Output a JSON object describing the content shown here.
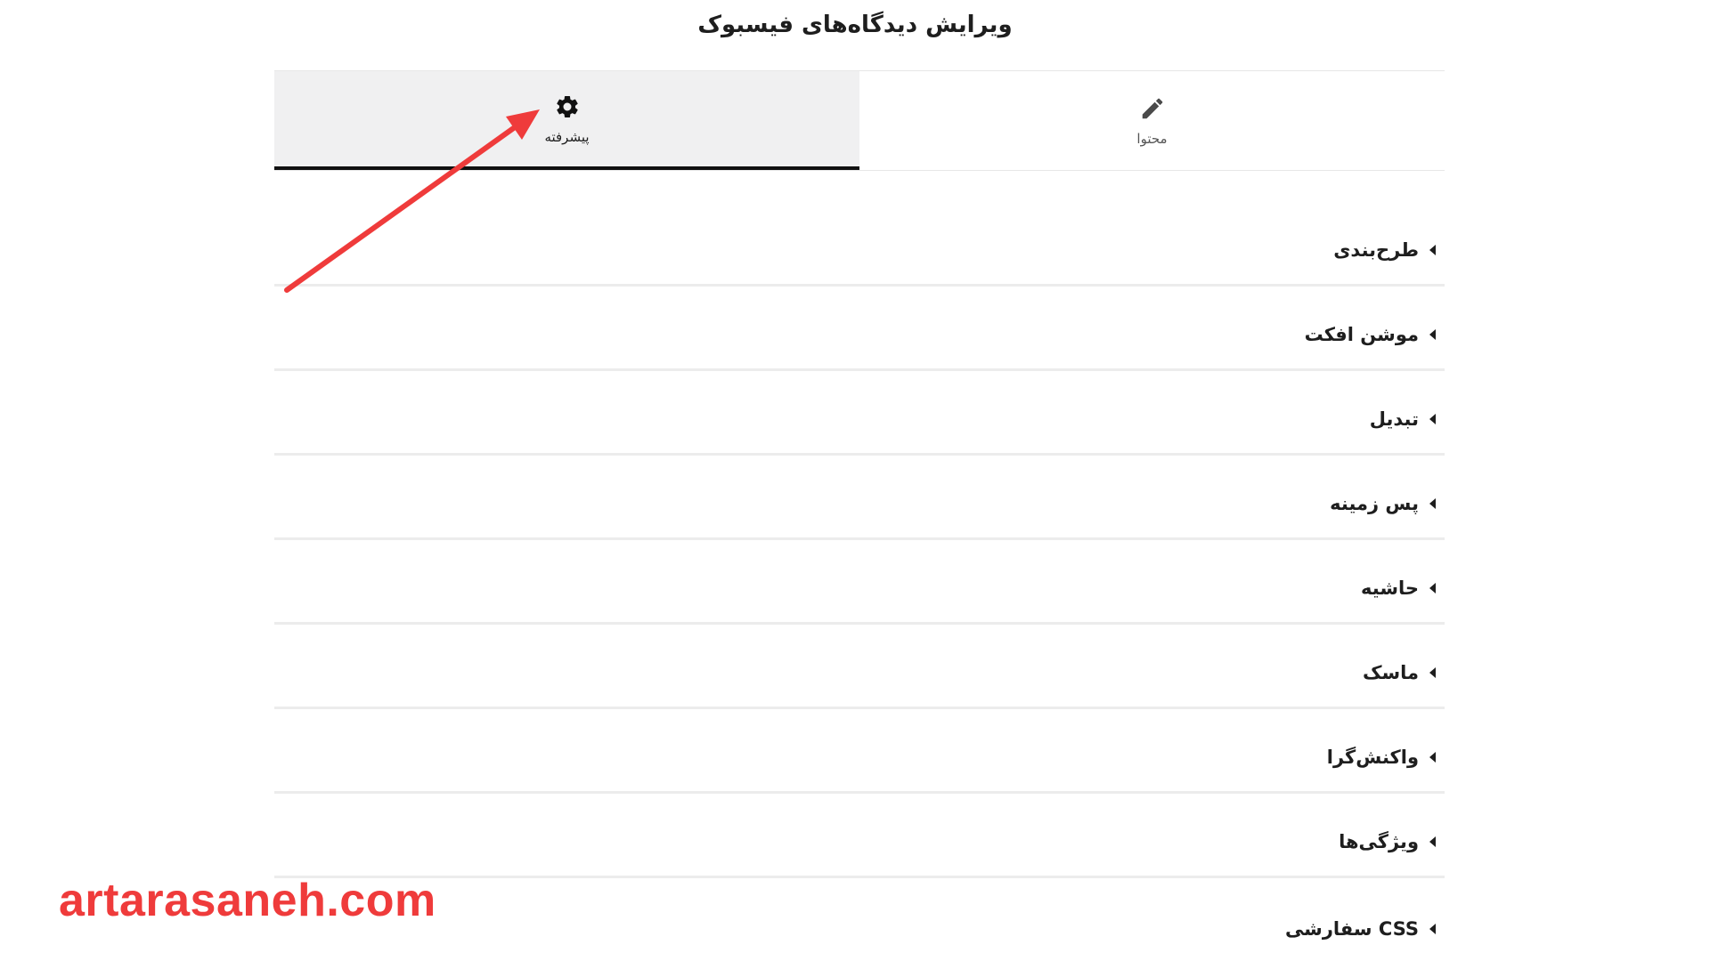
{
  "title": "ویرایش دیدگاه‌های فیسبوک",
  "tabs": [
    {
      "label": "محتوا",
      "icon": "pencil-icon",
      "active": false
    },
    {
      "label": "پیشرفته",
      "icon": "gear-icon",
      "active": true
    }
  ],
  "sections": [
    {
      "label": "طرح‌بندی"
    },
    {
      "label": "موشن افکت"
    },
    {
      "label": "تبدیل"
    },
    {
      "label": "پس زمینه"
    },
    {
      "label": "حاشیه"
    },
    {
      "label": "ماسک"
    },
    {
      "label": "واکنش‌گرا"
    },
    {
      "label": "ویژگی‌ها"
    },
    {
      "label": "CSS سفارشی"
    }
  ],
  "watermark": "artarasaneh.com",
  "colors": {
    "accent_arrow": "#ef3b3b",
    "active_tab_bg": "#f0f0f1",
    "active_tab_border": "#111111",
    "divider": "#ececec"
  }
}
